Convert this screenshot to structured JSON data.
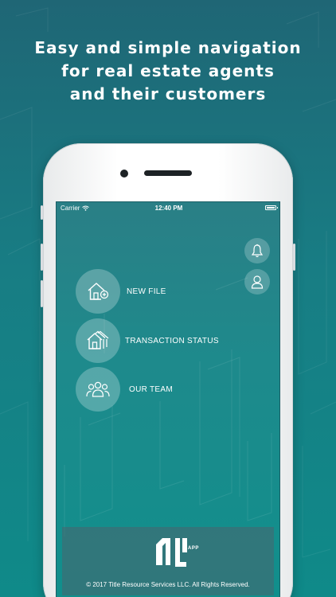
{
  "headline": {
    "line1": "Easy and simple navigation",
    "line2": "for real estate agents",
    "line3": "and their customers"
  },
  "status_bar": {
    "carrier": "Carrier",
    "time": "12:40 PM",
    "battery_level": 1.0
  },
  "top_actions": {
    "notifications_icon": "bell-icon",
    "profile_icon": "user-icon"
  },
  "menu": [
    {
      "label": "NEW FILE",
      "icon": "house-plus-icon"
    },
    {
      "label": "TRANSACTION STATUS",
      "icon": "houses-icon"
    },
    {
      "label": "OUR TEAM",
      "icon": "team-icon"
    }
  ],
  "footer": {
    "logo_text": "APP",
    "copyright": "© 2017 Title Resource Services LLC. All Rights Reserved."
  },
  "colors": {
    "background_top": "#1f6675",
    "background_bottom": "#0f8a89",
    "screen_teal": "#1e8a8c",
    "footer_panel": "#4a646e",
    "text": "#ffffff"
  }
}
